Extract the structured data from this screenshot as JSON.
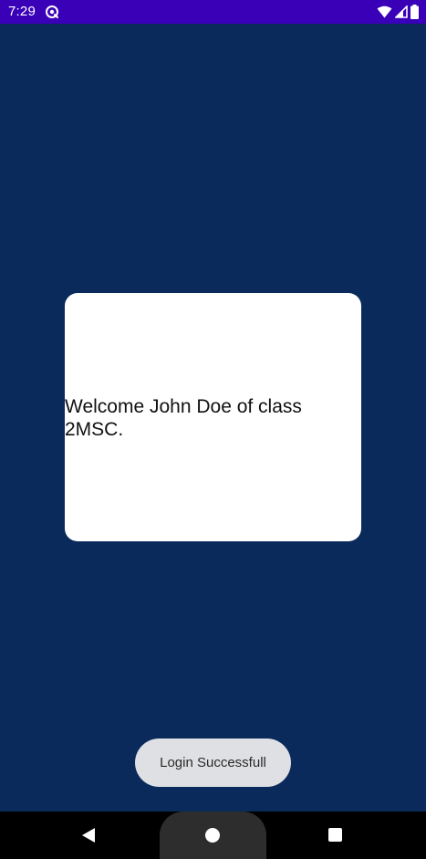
{
  "status_bar": {
    "time": "7:29",
    "icons": [
      "sync-icon",
      "wifi-icon",
      "signal-icon",
      "battery-icon"
    ],
    "background_color": "#3a00b8"
  },
  "app": {
    "background_color": "#0a2a5c",
    "card": {
      "message": "Welcome John Doe of class 2MSC."
    }
  },
  "toast": {
    "text": "Login Successfull"
  },
  "navigation_bar": {
    "buttons": [
      "back-icon",
      "home-icon",
      "recents-icon"
    ]
  }
}
